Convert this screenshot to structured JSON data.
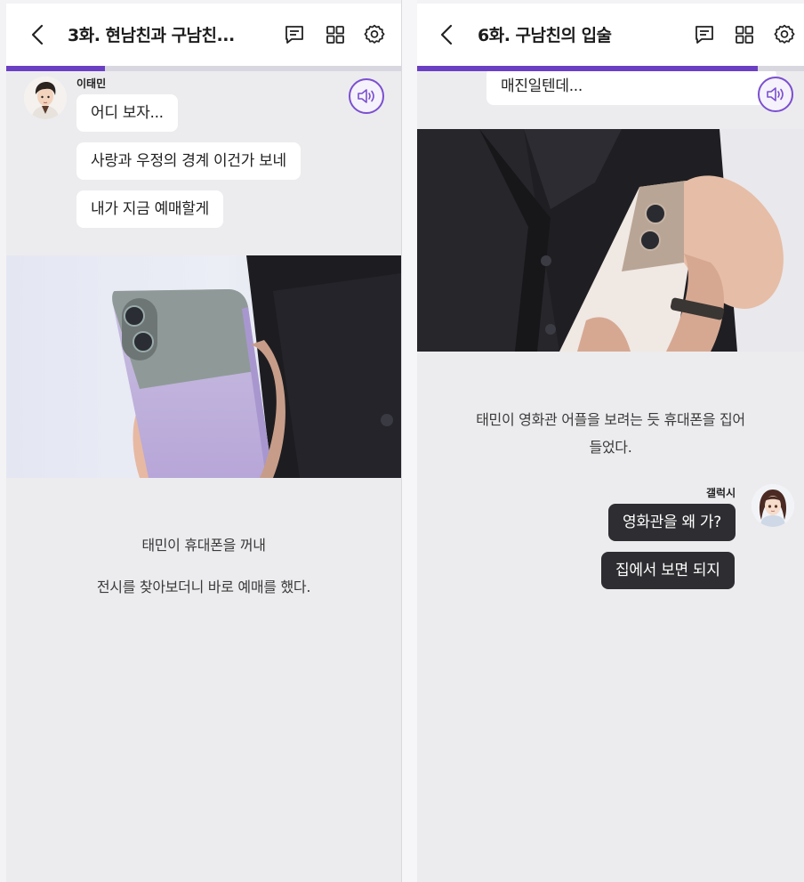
{
  "left": {
    "header": {
      "title": "3화. 현남친과 구남친..."
    },
    "progress": 0.25,
    "speaker": {
      "name": "이태민"
    },
    "messages": [
      "어디 보자...",
      "사랑과 우정의 경계 이건가 보네",
      "내가 지금 예매할게"
    ],
    "narration": [
      "태민이 휴대폰을 꺼내",
      "전시를 찾아보더니 바로 예매를 했다."
    ]
  },
  "right": {
    "header": {
      "title": "6화. 구남친의 입술"
    },
    "progress": 0.88,
    "partial_message": "매진일텐데...",
    "narration": [
      "태민이 영화관 어플을 보려는 듯 휴대폰을 집어",
      "들었다."
    ],
    "speaker": {
      "name": "갤럭시"
    },
    "messages": [
      "영화관을 왜 가?",
      "집에서 보면 되지"
    ]
  },
  "colors": {
    "accent": "#6b3fc4",
    "dark_bubble": "#2e2e32",
    "background": "#ececef"
  },
  "icons": [
    "back-chevron-icon",
    "message-list-icon",
    "grid-icon",
    "gear-icon",
    "speaker-icon"
  ]
}
